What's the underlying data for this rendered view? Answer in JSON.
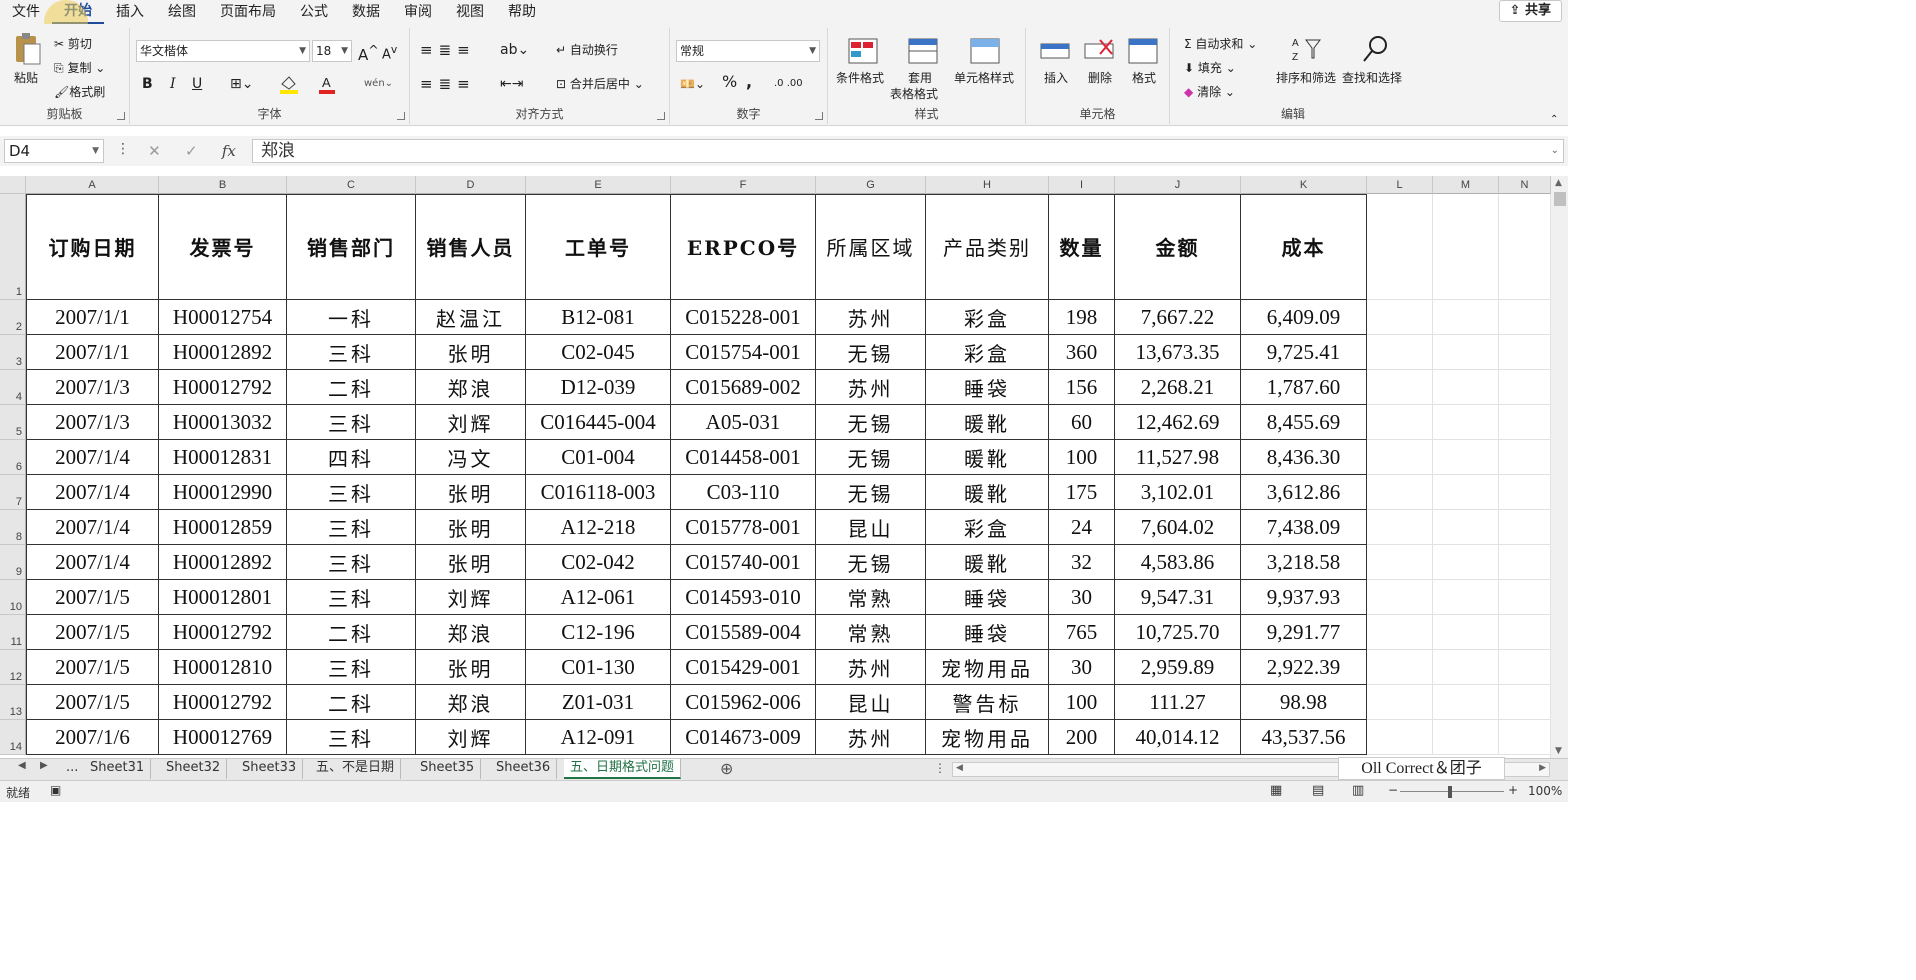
{
  "menu": {
    "tabs": [
      "文件",
      "开始",
      "插入",
      "绘图",
      "页面布局",
      "公式",
      "数据",
      "审阅",
      "视图",
      "帮助"
    ],
    "active_tab": "开始",
    "share_label": "共享"
  },
  "ribbon": {
    "clipboard": {
      "paste": "粘贴",
      "cut": "剪切",
      "copy": "复制",
      "format_painter": "格式刷",
      "label": "剪贴板"
    },
    "font": {
      "font_name": "华文楷体",
      "font_size": "18",
      "bold": "B",
      "italic": "I",
      "underline": "U",
      "label": "字体"
    },
    "alignment": {
      "wrap_text": "自动换行",
      "merge_center": "合并后居中",
      "label": "对齐方式"
    },
    "number": {
      "format": "常规",
      "percent": "%",
      "comma": ",",
      "label": "数字"
    },
    "styles": {
      "conditional": "条件格式",
      "table_format_1": "套用",
      "table_format_2": "表格格式",
      "cell_styles": "单元格样式",
      "label": "样式"
    },
    "cells": {
      "insert": "插入",
      "delete": "删除",
      "format": "格式",
      "label": "单元格"
    },
    "editing": {
      "autosum": "自动求和",
      "fill": "填充",
      "clear": "清除",
      "sort_filter": "排序和筛选",
      "find_select": "查找和选择",
      "label": "编辑"
    }
  },
  "formula_bar": {
    "name_box": "D4",
    "fx": "fx",
    "cancel": "✕",
    "enter": "✓",
    "content": "郑浪"
  },
  "columns": [
    "A",
    "B",
    "C",
    "D",
    "E",
    "F",
    "G",
    "H",
    "I",
    "J",
    "K",
    "L",
    "M",
    "N"
  ],
  "header_row": [
    "订购日期",
    "发票号",
    "销售部门",
    "销售人员",
    "工单号",
    "ERPCO号",
    "所属区域",
    "产品类别",
    "数量",
    "金额",
    "成本"
  ],
  "rows": [
    {
      "n": "2",
      "cells": [
        "2007/1/1",
        "H00012754",
        "一科",
        "赵温江",
        "B12-081",
        "C015228-001",
        "苏州",
        "彩盒",
        "198",
        "7,667.22",
        "6,409.09"
      ]
    },
    {
      "n": "3",
      "cells": [
        "2007/1/1",
        "H00012892",
        "三科",
        "张明",
        "C02-045",
        "C015754-001",
        "无锡",
        "彩盒",
        "360",
        "13,673.35",
        "9,725.41"
      ]
    },
    {
      "n": "4",
      "cells": [
        "2007/1/3",
        "H00012792",
        "二科",
        "郑浪",
        "D12-039",
        "C015689-002",
        "苏州",
        "睡袋",
        "156",
        "2,268.21",
        "1,787.60"
      ]
    },
    {
      "n": "5",
      "cells": [
        "2007/1/3",
        "H00013032",
        "三科",
        "刘辉",
        "C016445-004",
        "A05-031",
        "无锡",
        "暖靴",
        "60",
        "12,462.69",
        "8,455.69"
      ]
    },
    {
      "n": "6",
      "cells": [
        "2007/1/4",
        "H00012831",
        "四科",
        "冯文",
        "C01-004",
        "C014458-001",
        "无锡",
        "暖靴",
        "100",
        "11,527.98",
        "8,436.30"
      ]
    },
    {
      "n": "7",
      "cells": [
        "2007/1/4",
        "H00012990",
        "三科",
        "张明",
        "C016118-003",
        "C03-110",
        "无锡",
        "暖靴",
        "175",
        "3,102.01",
        "3,612.86"
      ]
    },
    {
      "n": "8",
      "cells": [
        "2007/1/4",
        "H00012859",
        "三科",
        "张明",
        "A12-218",
        "C015778-001",
        "昆山",
        "彩盒",
        "24",
        "7,604.02",
        "7,438.09"
      ]
    },
    {
      "n": "9",
      "cells": [
        "2007/1/4",
        "H00012892",
        "三科",
        "张明",
        "C02-042",
        "C015740-001",
        "无锡",
        "暖靴",
        "32",
        "4,583.86",
        "3,218.58"
      ]
    },
    {
      "n": "10",
      "cells": [
        "2007/1/5",
        "H00012801",
        "三科",
        "刘辉",
        "A12-061",
        "C014593-010",
        "常熟",
        "睡袋",
        "30",
        "9,547.31",
        "9,937.93"
      ]
    },
    {
      "n": "11",
      "cells": [
        "2007/1/5",
        "H00012792",
        "二科",
        "郑浪",
        "C12-196",
        "C015589-004",
        "常熟",
        "睡袋",
        "765",
        "10,725.70",
        "9,291.77"
      ]
    },
    {
      "n": "12",
      "cells": [
        "2007/1/5",
        "H00012810",
        "三科",
        "张明",
        "C01-130",
        "C015429-001",
        "苏州",
        "宠物用品",
        "30",
        "2,959.89",
        "2,922.39"
      ]
    },
    {
      "n": "13",
      "cells": [
        "2007/1/5",
        "H00012792",
        "二科",
        "郑浪",
        "Z01-031",
        "C015962-006",
        "昆山",
        "警告标",
        "100",
        "111.27",
        "98.98"
      ]
    },
    {
      "n": "14",
      "cells": [
        "2007/1/6",
        "H00012769",
        "三科",
        "刘辉",
        "A12-091",
        "C014673-009",
        "苏州",
        "宠物用品",
        "200",
        "40,014.12",
        "43,537.56"
      ]
    }
  ],
  "sheet_tabs": [
    "...",
    "Sheet31",
    "Sheet32",
    "Sheet33",
    "五、不是日期",
    "Sheet35",
    "Sheet36",
    "五、日期格式问题"
  ],
  "active_sheet": "五、日期格式问题",
  "watermark": "Oll Correct＆团子",
  "status": {
    "ready": "就绪",
    "zoom": "100%"
  }
}
